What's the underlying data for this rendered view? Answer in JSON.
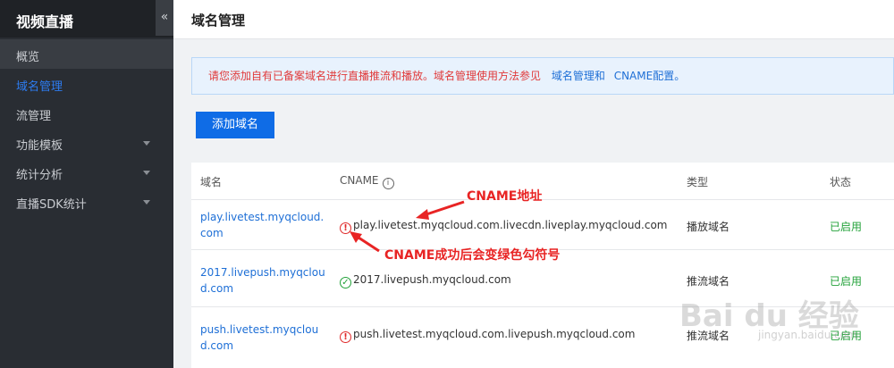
{
  "sidebar": {
    "title": "视频直播",
    "collapse_label": "«",
    "items": [
      {
        "label": "概览"
      },
      {
        "label": "域名管理"
      },
      {
        "label": "流管理"
      },
      {
        "label": "功能模板"
      },
      {
        "label": "统计分析"
      },
      {
        "label": "直播SDK统计"
      }
    ]
  },
  "header": {
    "title": "域名管理"
  },
  "notice": {
    "text": "请您添加自有已备案域名进行直播推流和播放。域名管理使用方法参见",
    "link1": "域名管理和",
    "link2": "CNAME配置。"
  },
  "add_button": "添加域名",
  "table": {
    "columns": [
      "域名",
      "CNAME",
      "类型",
      "状态"
    ],
    "rows": [
      {
        "domain": "play.livetest.myqcloud.com",
        "cname": "play.livetest.myqcloud.com.livecdn.liveplay.myqcloud.com",
        "type": "播放域名",
        "status": "已启用",
        "icon": "error-circle-icon"
      },
      {
        "domain": "2017.livepush.myqcloud.com",
        "cname": "2017.livepush.myqcloud.com",
        "type": "推流域名",
        "status": "已启用",
        "icon": "check-circle-icon"
      },
      {
        "domain": "push.livetest.myqcloud.com",
        "cname": "push.livetest.myqcloud.com.livepush.myqcloud.com",
        "type": "推流域名",
        "status": "已启用",
        "icon": "error-circle-icon"
      }
    ]
  },
  "annotations": {
    "cname_address": "CNAME地址",
    "cname_success": "CNAME成功后会变绿色勾符号"
  },
  "watermark": {
    "brand": "Bai du 经验",
    "url": "jingyan.baidu.com"
  },
  "colors": {
    "accent": "#0f6ce6",
    "link": "#1e6fd6",
    "ok": "#23a23a",
    "error": "#e02b2b",
    "annotation": "#e82424"
  }
}
